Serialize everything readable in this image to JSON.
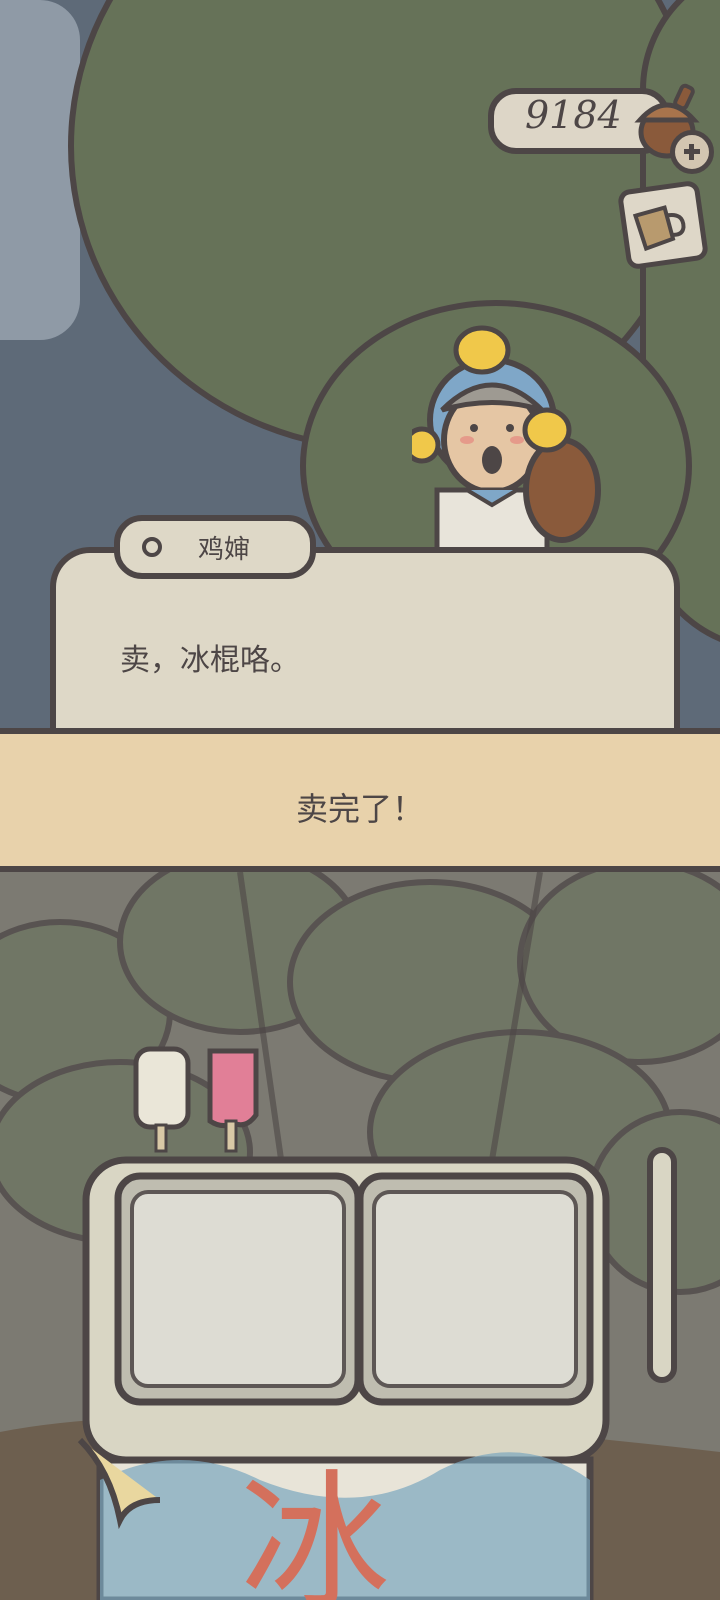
{
  "hud": {
    "acorn_count": "9184",
    "acorn_icon": "acorn-icon",
    "add_icon": "plus-icon",
    "cup_icon": "cup-icon"
  },
  "dialog": {
    "speaker": "鸡婶",
    "text": "卖，冰棍咯。"
  },
  "banner": {
    "text": "卖完了！"
  },
  "cart": {
    "sign_char": "冰"
  },
  "colors": {
    "outline": "#4d4646",
    "foliage": "#667258",
    "dialog_bg": "#ded8c7",
    "banner_bg": "#e8d2ab",
    "sky": "#5e6a78"
  }
}
